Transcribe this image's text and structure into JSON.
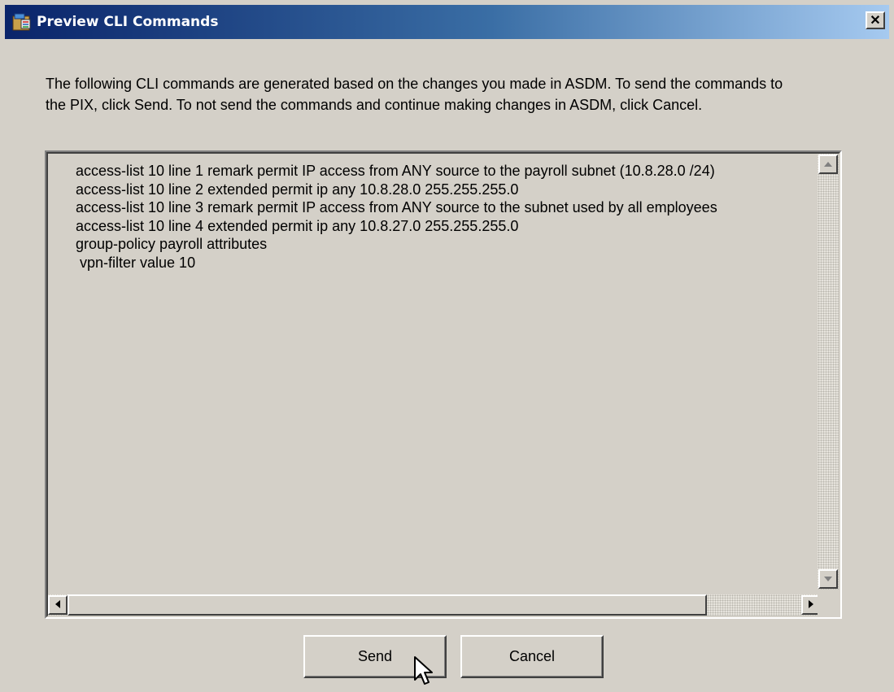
{
  "window": {
    "title": "Preview CLI Commands",
    "close_label": "✕"
  },
  "instructions": "The following CLI commands are generated based on the changes you made in ASDM.  To send the commands to the PIX, click Send.  To not send the commands and continue making changes in ASDM, click Cancel.",
  "commands": [
    "access-list 10 line 1 remark permit IP access from ANY source to the payroll subnet (10.8.28.0 /24)",
    "access-list 10 line 2 extended permit ip any 10.8.28.0 255.255.255.0",
    "access-list 10 line 3 remark permit IP access from ANY source to the subnet used by all employees",
    "access-list 10 line 4 extended permit ip any 10.8.27.0 255.255.255.0",
    "group-policy payroll attributes",
    " vpn-filter value 10"
  ],
  "buttons": {
    "send": "Send",
    "cancel": "Cancel"
  },
  "icons": {
    "title": "app-icon",
    "close": "close-icon",
    "scroll_up": "arrow-up-icon",
    "scroll_down": "arrow-down-icon",
    "scroll_left": "arrow-left-icon",
    "scroll_right": "arrow-right-icon",
    "cursor": "mouse-pointer-icon"
  }
}
